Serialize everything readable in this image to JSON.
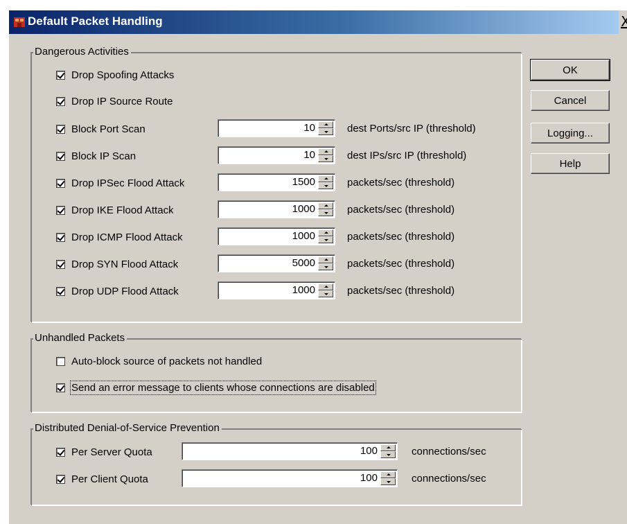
{
  "window": {
    "title": "Default Packet Handling",
    "close_label": "X"
  },
  "buttons": {
    "ok": "OK",
    "cancel": "Cancel",
    "logging": "Logging...",
    "help": "Help"
  },
  "dangerous": {
    "legend": "Dangerous Activities",
    "items": [
      {
        "label": "Drop Spoofing Attacks",
        "checked": true
      },
      {
        "label": "Drop IP Source Route",
        "checked": true
      },
      {
        "label": "Block Port Scan",
        "checked": true,
        "value": "10",
        "unit": "dest Ports/src IP (threshold)"
      },
      {
        "label": "Block IP Scan",
        "checked": true,
        "value": "10",
        "unit": "dest IPs/src IP (threshold)"
      },
      {
        "label": "Drop IPSec Flood Attack",
        "checked": true,
        "value": "1500",
        "unit": "packets/sec (threshold)"
      },
      {
        "label": "Drop IKE Flood Attack",
        "checked": true,
        "value": "1000",
        "unit": "packets/sec (threshold)"
      },
      {
        "label": "Drop ICMP Flood Attack",
        "checked": true,
        "value": "1000",
        "unit": "packets/sec (threshold)"
      },
      {
        "label": "Drop SYN Flood Attack",
        "checked": true,
        "value": "5000",
        "unit": "packets/sec (threshold)"
      },
      {
        "label": "Drop UDP Flood Attack",
        "checked": true,
        "value": "1000",
        "unit": "packets/sec (threshold)"
      }
    ]
  },
  "unhandled": {
    "legend": "Unhandled Packets",
    "items": [
      {
        "label": "Auto-block source of packets not handled",
        "checked": false
      },
      {
        "label": "Send an error message to clients whose connections are disabled",
        "checked": true
      }
    ]
  },
  "ddos": {
    "legend": "Distributed Denial-of-Service Prevention",
    "items": [
      {
        "label": "Per Server Quota",
        "checked": true,
        "value": "100",
        "unit": "connections/sec"
      },
      {
        "label": "Per Client Quota",
        "checked": true,
        "value": "100",
        "unit": "connections/sec"
      }
    ]
  },
  "icons": {
    "app": "firebox-app-icon",
    "close": "close-icon",
    "spin_up": "spin-up-arrow-icon",
    "spin_down": "spin-down-arrow-icon"
  },
  "colors": {
    "dialog_bg": "#d4d0c8",
    "title_start": "#0a246a",
    "title_end": "#a6caf0"
  }
}
